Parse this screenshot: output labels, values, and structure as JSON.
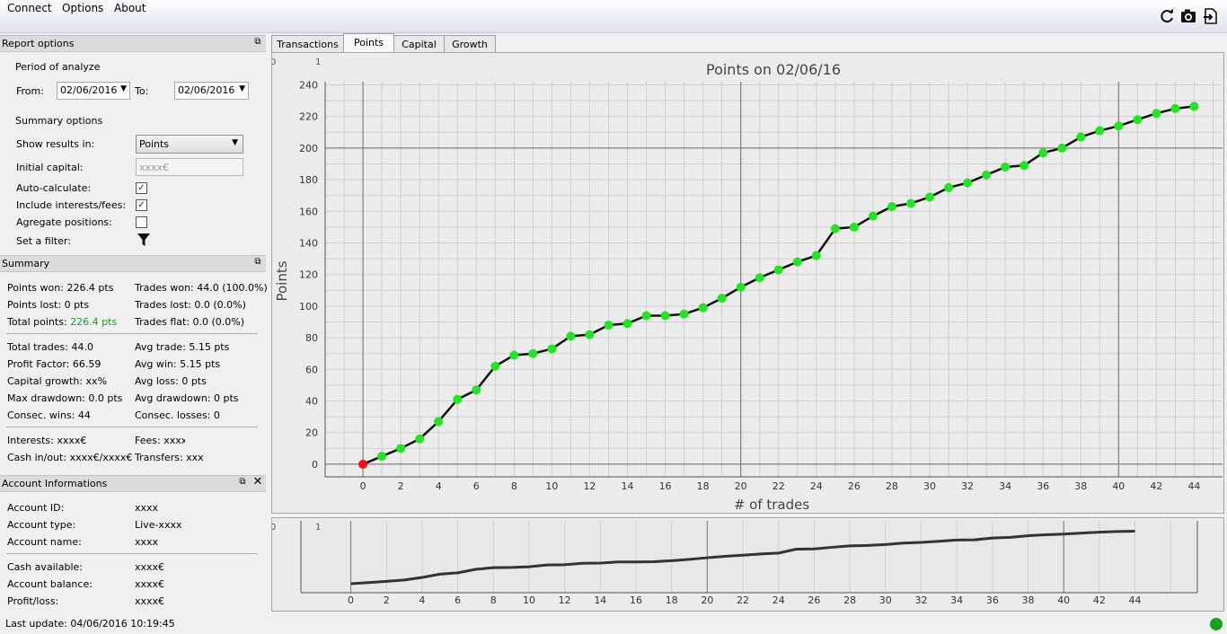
{
  "menu": [
    "Connect",
    "Options",
    "About"
  ],
  "toolbar_icons": [
    "refresh-icon",
    "camera-icon",
    "export-icon"
  ],
  "report_options": {
    "title": "Report options",
    "period_label": "Period of analyze",
    "from_label": "From:",
    "from_value": "02/06/2016",
    "to_label": "To:",
    "to_value": "02/06/2016",
    "summary_options_label": "Summary options",
    "show_results_label": "Show results in:",
    "show_results_value": "Points",
    "initial_capital_label": "Initial capital:",
    "initial_capital_placeholder": "xxxx€",
    "auto_calc_label": "Auto-calculate:",
    "auto_calc_checked": true,
    "include_fees_label": "Include interests/fees:",
    "include_fees_checked": true,
    "aggregate_label": "Agregate positions:",
    "aggregate_checked": false,
    "filter_label": "Set a filter:"
  },
  "summary": {
    "title": "Summary",
    "points_won": "Points won: 226.4 pts",
    "points_lost": "Points lost: 0 pts",
    "total_points_label": "Total points:",
    "total_points_value": "226.4 pts",
    "trades_won": "Trades won: 44.0 (100.0%)",
    "trades_lost": "Trades lost: 0.0 (0.0%)",
    "trades_flat": "Trades flat: 0.0 (0.0%)",
    "total_trades": "Total trades: 44.0",
    "profit_factor": "Profit Factor: 66.59",
    "capital_growth": "Capital growth: xx%",
    "max_drawdown": "Max drawdown: 0.0 pts",
    "consec_wins": "Consec. wins: 44",
    "avg_trade": "Avg trade: 5.15 pts",
    "avg_win": "Avg win: 5.15 pts",
    "avg_loss": "Avg loss: 0 pts",
    "avg_drawdown": "Avg drawdown: 0 pts",
    "consec_losses": "Consec. losses: 0",
    "interests": "Interests: xxxx€",
    "cash_inout": "Cash in/out: xxxx€/xxxx€",
    "fees": "Fees: xxxx€",
    "transfers": "Transfers: xxxx€"
  },
  "account": {
    "title": "Account Informations",
    "rows1": [
      {
        "label": "Account ID:",
        "value": "xxxx"
      },
      {
        "label": "Account type:",
        "value": "Live-xxxx"
      },
      {
        "label": "Account name:",
        "value": "xxxx"
      }
    ],
    "rows2": [
      {
        "label": "Cash available:",
        "value": "xxxx€"
      },
      {
        "label": "Account balance:",
        "value": "xxxx€"
      },
      {
        "label": "Profit/loss:",
        "value": "xxxx€"
      }
    ]
  },
  "tabs": [
    "Transactions",
    "Points",
    "Capital",
    "Growth"
  ],
  "active_tab": "Points",
  "status": "Last update: 04/06/2016 10:19:45",
  "colors": {
    "positive": "#1aa31a",
    "point": "#22e622",
    "first_point": "#ee1111"
  },
  "chart_data": {
    "type": "line",
    "title": "Points on 02/06/16",
    "xlabel": "# of trades",
    "ylabel": "Points",
    "xlim": [
      -2,
      45.5
    ],
    "ylim": [
      -8,
      242
    ],
    "x_ticks": [
      0,
      2,
      4,
      6,
      8,
      10,
      12,
      14,
      16,
      18,
      20,
      22,
      24,
      26,
      28,
      30,
      32,
      34,
      36,
      38,
      40,
      42,
      44
    ],
    "y_ticks": [
      0,
      20,
      40,
      60,
      80,
      100,
      120,
      140,
      160,
      180,
      200,
      220,
      240
    ],
    "corner_labels": [
      "0",
      "1"
    ],
    "x": [
      0,
      1,
      2,
      3,
      4,
      5,
      6,
      7,
      8,
      9,
      10,
      11,
      12,
      13,
      14,
      15,
      16,
      17,
      18,
      19,
      20,
      21,
      22,
      23,
      24,
      25,
      26,
      27,
      28,
      29,
      30,
      31,
      32,
      33,
      34,
      35,
      36,
      37,
      38,
      39,
      40,
      41,
      42,
      43,
      44
    ],
    "y": [
      0,
      5,
      10,
      16,
      27,
      41,
      47,
      62,
      69,
      70,
      73,
      81,
      82,
      88,
      89,
      94,
      94,
      95,
      99,
      105,
      112,
      118,
      123,
      128,
      132,
      149,
      150,
      157,
      163,
      165,
      169,
      175,
      178,
      183,
      188,
      189,
      197,
      200,
      207,
      211,
      214,
      218,
      222,
      225,
      226.4
    ],
    "grid": true,
    "overview": {
      "x_ticks": [
        0,
        2,
        4,
        6,
        8,
        10,
        12,
        14,
        16,
        18,
        20,
        22,
        24,
        26,
        28,
        30,
        32,
        34,
        36,
        38,
        40,
        42,
        44
      ],
      "corner_labels": [
        "0",
        "1"
      ]
    }
  }
}
